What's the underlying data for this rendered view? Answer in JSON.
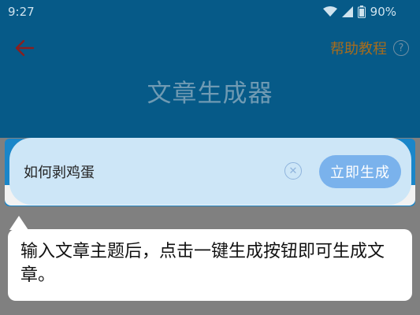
{
  "status_bar": {
    "time": "9:27",
    "battery": "90%"
  },
  "header": {
    "back_icon": "arrow-left-icon",
    "help_label": "帮助教程",
    "help_icon": "question-circle-icon",
    "title": "文章生成器",
    "background_color": "#065a88"
  },
  "search": {
    "value": "如何剥鸡蛋",
    "clear_icon": "clear-circle-icon",
    "generate_label": "立即生成"
  },
  "tooltip": {
    "text": "输入文章主题后，点击一键生成按钮即可生成文章。"
  }
}
